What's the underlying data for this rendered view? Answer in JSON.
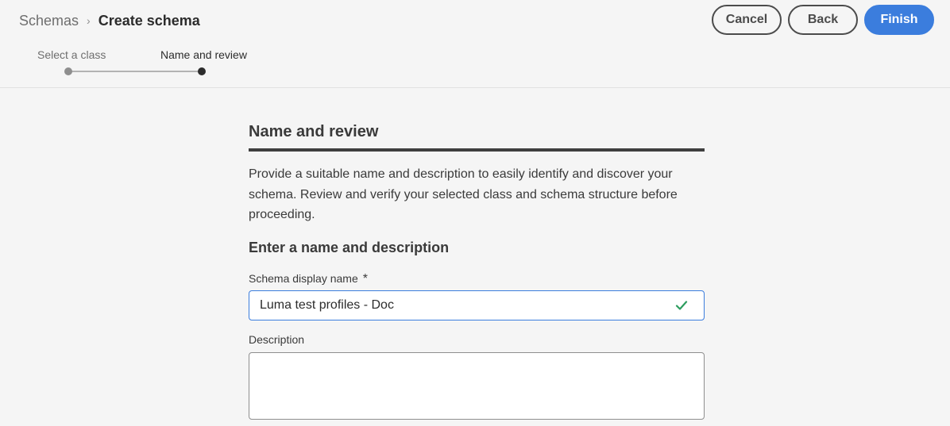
{
  "breadcrumb": {
    "parent": "Schemas",
    "separator": "›",
    "current": "Create schema"
  },
  "actions": {
    "cancel": "Cancel",
    "back": "Back",
    "finish": "Finish"
  },
  "stepper": {
    "steps": [
      {
        "label": "Select a class",
        "state": "completed"
      },
      {
        "label": "Name and review",
        "state": "current"
      }
    ]
  },
  "main": {
    "section_title": "Name and review",
    "intro": "Provide a suitable name and description to easily identify and discover your schema. Review and verify your selected class and schema structure before proceeding.",
    "subhead": "Enter a name and description",
    "name_field": {
      "label": "Schema display name",
      "required_mark": "*",
      "value": "Luma test profiles - Doc",
      "status_icon": "checkmark-icon"
    },
    "description_field": {
      "label": "Description",
      "value": ""
    }
  },
  "colors": {
    "accent": "#3b7ddd",
    "valid": "#2d9d5f",
    "background": "#f5f5f5"
  }
}
